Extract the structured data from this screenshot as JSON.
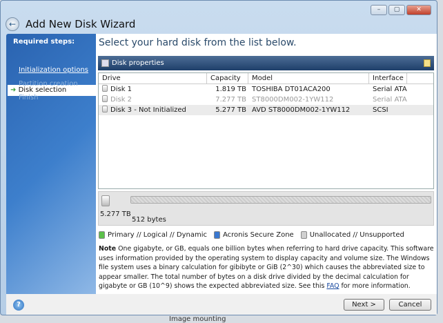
{
  "window": {
    "title": "Add New Disk Wizard",
    "min": "–",
    "max": "▢",
    "close": "✕"
  },
  "sidebar": {
    "heading": "Required steps:",
    "items": [
      {
        "label": "Disk selection"
      },
      {
        "label": "Initialization options"
      },
      {
        "label": "Partition creation"
      },
      {
        "label": "Finish"
      }
    ]
  },
  "main": {
    "heading": "Select your hard disk from the list below.",
    "panel_title": "Disk properties"
  },
  "table": {
    "columns": [
      "Drive",
      "Capacity",
      "Model",
      "Interface"
    ],
    "rows": [
      {
        "drive": "Disk 1",
        "capacity": "1.819 TB",
        "model": "TOSHIBA DT01ACA200",
        "interface": "Serial ATA"
      },
      {
        "drive": "Disk 2",
        "capacity": "7.277 TB",
        "model": "ST8000DM002-1YW112",
        "interface": "Serial ATA"
      },
      {
        "drive": "Disk 3 - Not Initialized",
        "capacity": "5.277 TB",
        "model": "AVD ST8000DM002-1YW112",
        "interface": "SCSI"
      }
    ]
  },
  "map": {
    "size": "5.277 TB",
    "sector": "512 bytes"
  },
  "legend": [
    "Primary // Logical // Dynamic",
    "Acronis Secure Zone",
    "Unallocated // Unsupported"
  ],
  "colors": {
    "primary": "#5cc04a",
    "secure_zone": "#3a78d0",
    "unallocated": "#d0d0d0"
  },
  "note": {
    "label": "Note",
    "text": " One gigabyte, or GB, equals one billion bytes when referring to hard drive capacity. This software uses information provided by the operating system to display capacity and volume size. The Windows file system uses a binary calculation for gibibyte or GiB (2^30) which causes the abbreviated size to appear smaller.  The total number of bytes on a disk drive divided by the decimal calculation for gigabyte or GB (10^9) shows the expected abbreviated size. See this ",
    "link": "FAQ",
    "tail": " for more information."
  },
  "buttons": {
    "next": "Next >",
    "cancel": "Cancel",
    "help": "?"
  },
  "background_text": "Image mounting"
}
